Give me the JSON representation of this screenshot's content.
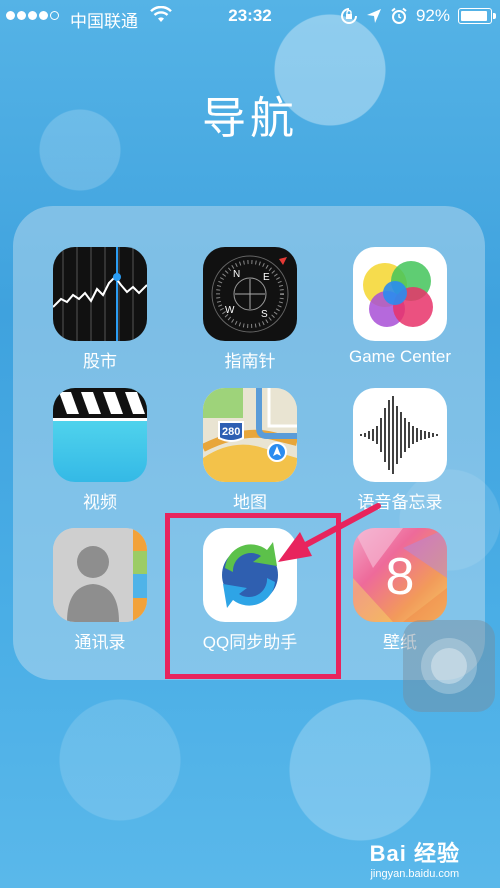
{
  "status_bar": {
    "carrier": "中国联通",
    "time": "23:32",
    "battery_percent": "92%",
    "battery_level": 0.92
  },
  "folder": {
    "title": "导航",
    "apps": [
      {
        "label": "股市",
        "icon": "stocks-icon"
      },
      {
        "label": "指南针",
        "icon": "compass-icon"
      },
      {
        "label": "Game Center",
        "icon": "game-center-icon"
      },
      {
        "label": "视频",
        "icon": "videos-icon"
      },
      {
        "label": "地图",
        "icon": "maps-icon"
      },
      {
        "label": "语音备忘录",
        "icon": "voice-memos-icon"
      },
      {
        "label": "通讯录",
        "icon": "contacts-icon"
      },
      {
        "label": "QQ同步助手",
        "icon": "qq-sync-icon"
      },
      {
        "label": "壁纸",
        "icon": "wallpaper-icon"
      }
    ]
  },
  "icon_text": {
    "compass": {
      "n": "N",
      "e": "E",
      "s": "S",
      "w": "W"
    },
    "maps_shield": "280",
    "wallpaper_digit": "8"
  },
  "watermark": {
    "logo": "Bai 经验",
    "url": "jingyan.baidu.com"
  },
  "colors": {
    "highlight": "#e8245d",
    "background": "#4aaee6"
  }
}
